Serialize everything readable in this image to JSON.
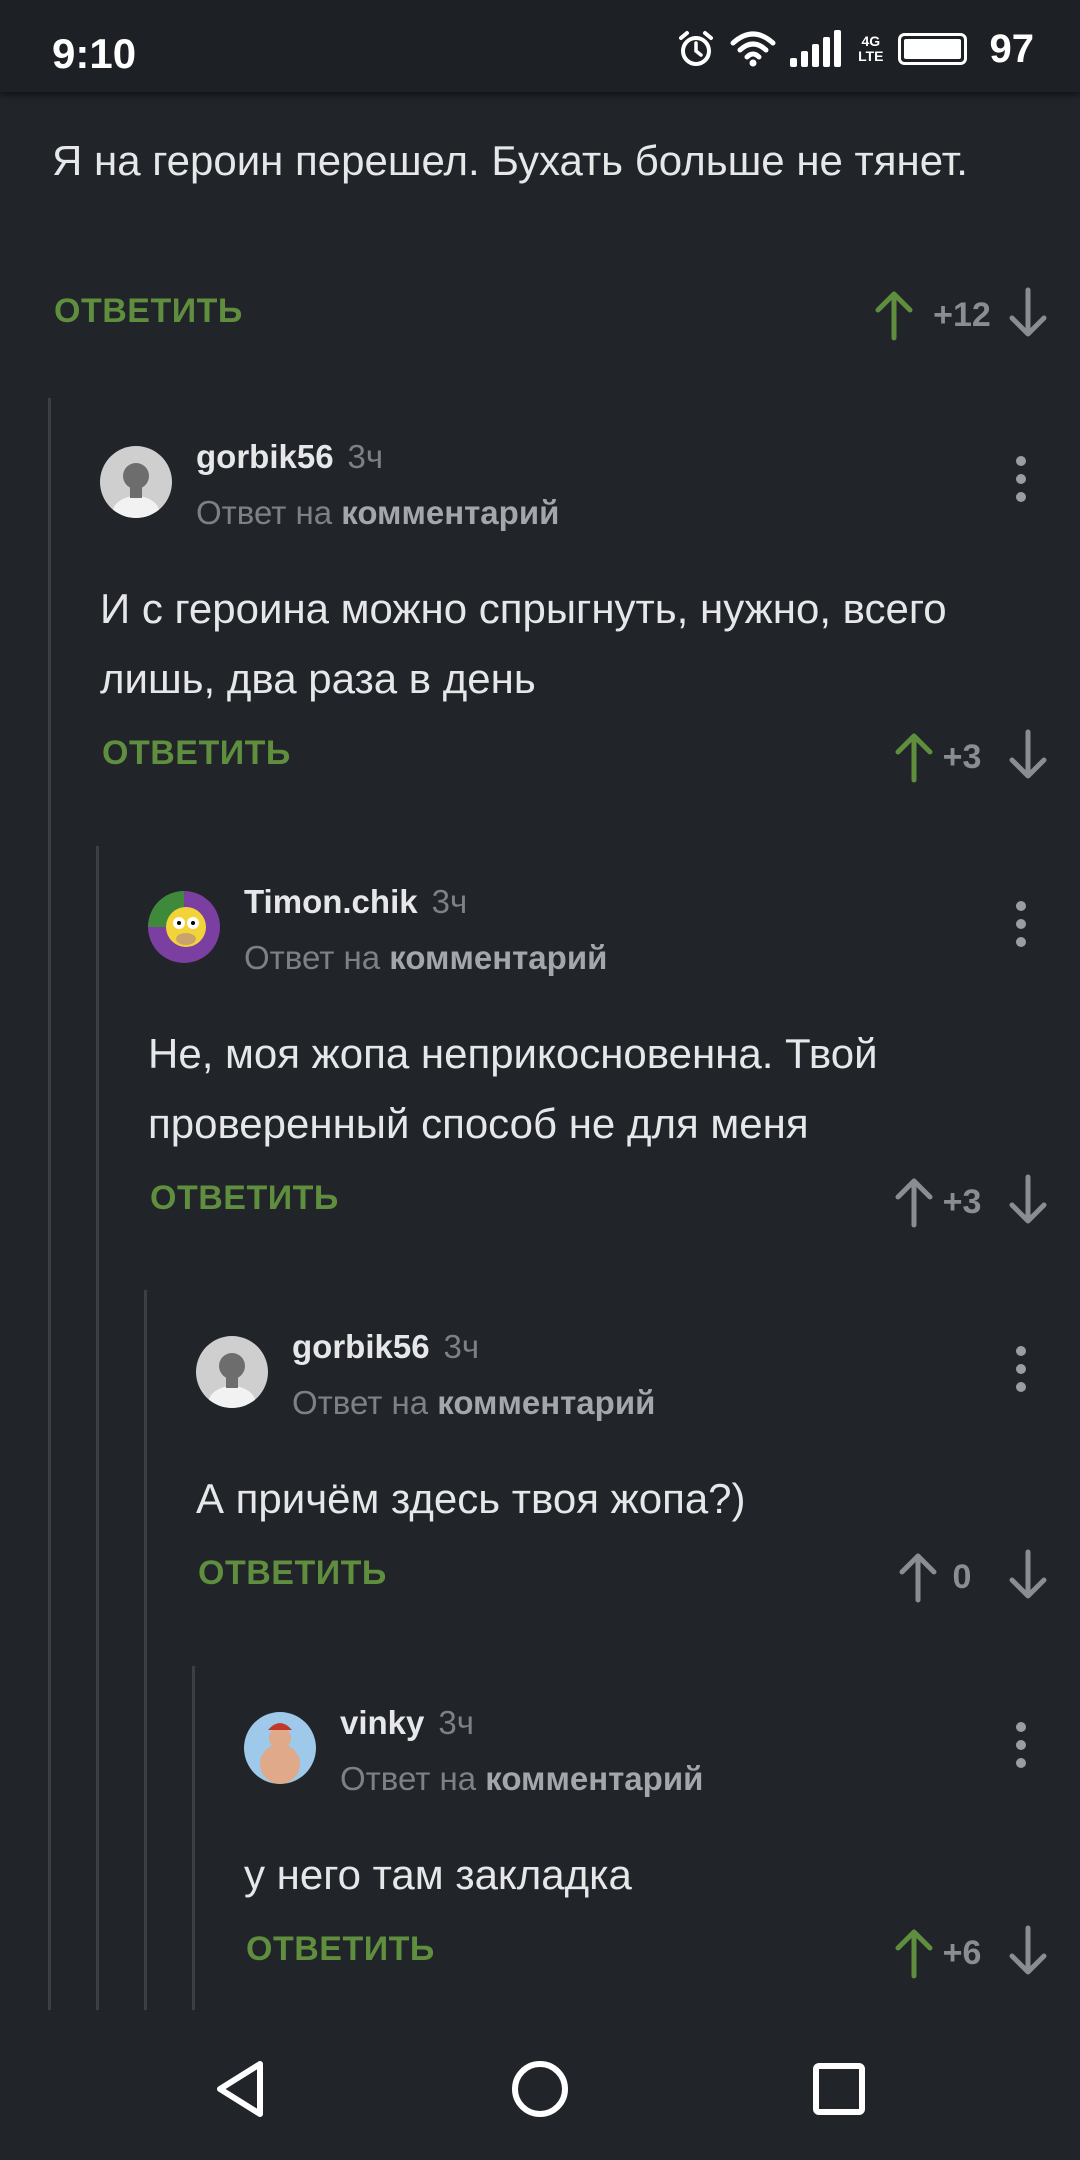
{
  "status_bar": {
    "time": "9:10",
    "network_type": "4G",
    "network_sub": "LTE",
    "battery": "97",
    "icons": [
      "alarm-icon",
      "wifi-icon",
      "signal-icon",
      "battery-icon"
    ]
  },
  "colors": {
    "background": "#212428",
    "accent_green": "#5f8e3e",
    "muted_text": "#7d8187",
    "thread_line": "#3b4047"
  },
  "comments": [
    {
      "text": "Я на героин перешел. Бухать больше не тянет.",
      "reply_label": "ОТВЕТИТЬ",
      "score": "+12",
      "upvoted": true
    },
    {
      "username": "gorbik56",
      "time": "3ч",
      "reply_prefix": "Ответ на",
      "reply_link": "комментарий",
      "text": "И с героина можно спрыгнуть, нужно, всего лишь, два раза в день",
      "reply_label": "ОТВЕТИТЬ",
      "score": "+3",
      "upvoted": true
    },
    {
      "username": "Timon.chik",
      "time": "3ч",
      "reply_prefix": "Ответ на",
      "reply_link": "комментарий",
      "text": "Не, моя жопа неприкосновенна. Твой проверенный способ не для меня",
      "reply_label": "ОТВЕТИТЬ",
      "score": "+3",
      "upvoted": false
    },
    {
      "username": "gorbik56",
      "time": "3ч",
      "reply_prefix": "Ответ на",
      "reply_link": "комментарий",
      "text": "А причём здесь твоя жопа?)",
      "reply_label": "ОТВЕТИТЬ",
      "score": "0",
      "upvoted": false
    },
    {
      "username": "vinky",
      "time": "3ч",
      "reply_prefix": "Ответ на",
      "reply_link": "комментарий",
      "text": "у него там закладка",
      "reply_label": "ОТВЕТИТЬ",
      "score": "+6",
      "upvoted": true
    }
  ],
  "nav_bar": {
    "icons": [
      "back-icon",
      "home-icon",
      "recents-icon"
    ]
  }
}
